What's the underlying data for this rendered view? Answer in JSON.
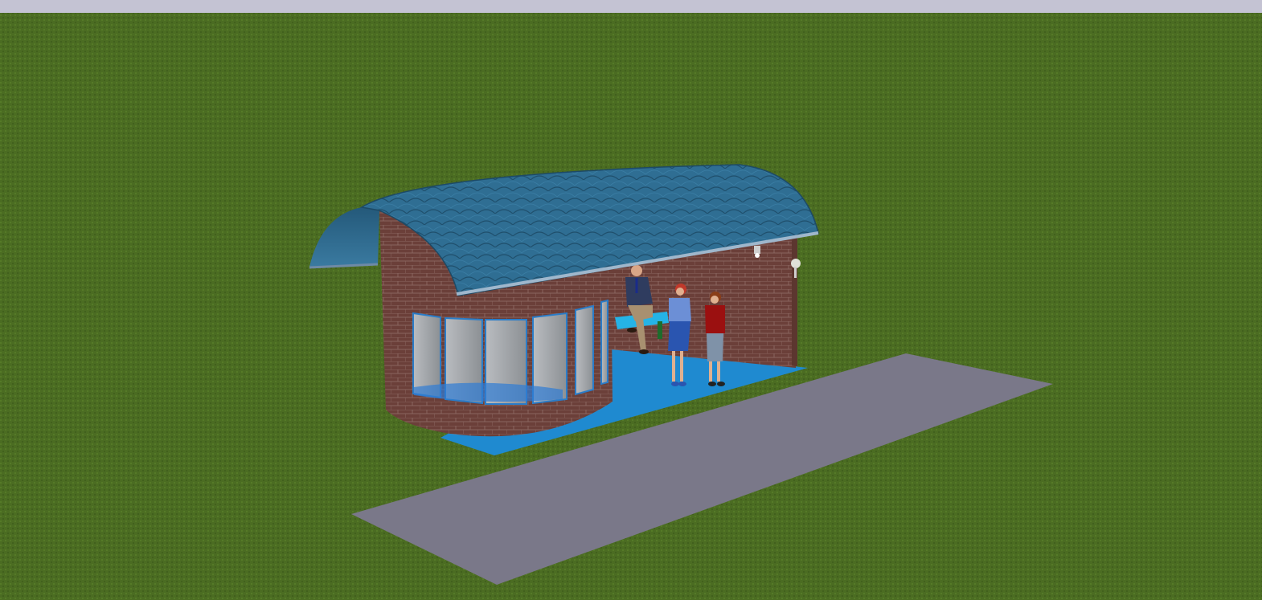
{
  "app": {
    "title": ""
  },
  "viewport": {
    "mode": "3d-view",
    "scene_objects": [
      "ground-grass",
      "paved-walkway",
      "blue-floor-slab",
      "brick-shelter-walls",
      "barrel-roof",
      "curved-glass-windows",
      "bench",
      "seated-man",
      "standing-woman",
      "standing-boy",
      "wall-lamp",
      "ceiling-lamp"
    ],
    "colors": {
      "sky_strip": "#c4c3d3",
      "grass": "#4a6b22",
      "walkway": "#7a7889",
      "floor": "#1f8ad0",
      "brick": "#6a3f38",
      "roof": "#2f6f94",
      "glass": "#9aa0a6"
    }
  }
}
